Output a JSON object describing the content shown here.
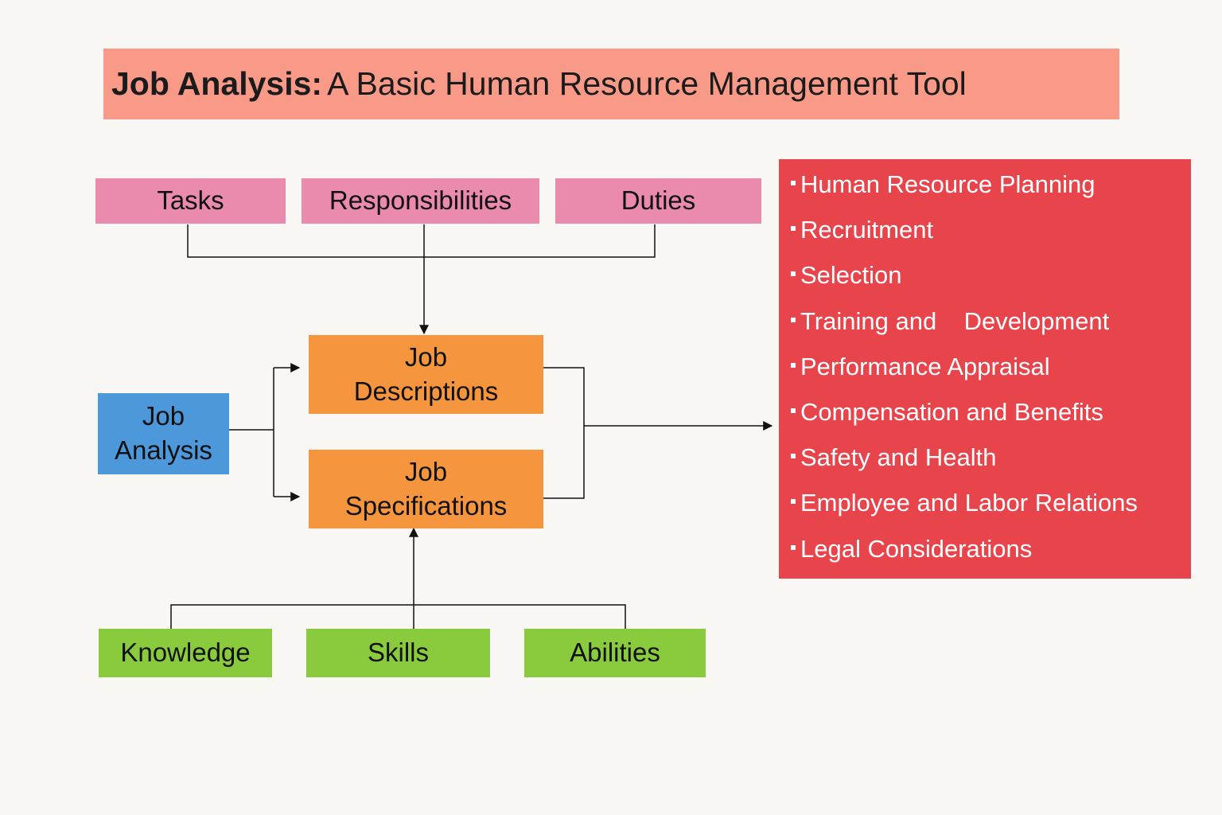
{
  "title": {
    "bold": "Job Analysis:",
    "rest": "A Basic Human Resource Management Tool"
  },
  "top_row": [
    "Tasks",
    "Responsibilities",
    "Duties"
  ],
  "source": {
    "line1": "Job",
    "line2": "Analysis"
  },
  "outputs": {
    "descriptions": {
      "line1": "Job",
      "line2": "Descriptions"
    },
    "specifications": {
      "line1": "Job",
      "line2": "Specifications"
    }
  },
  "bottom_row": [
    "Knowledge",
    "Skills",
    "Abilities"
  ],
  "uses": [
    "Human Resource Planning",
    "Recruitment",
    "Selection",
    "Training and    Development",
    "Performance Appraisal",
    "Compensation and Benefits",
    "Safety and Health",
    "Employee and Labor Relations",
    "Legal Considerations"
  ],
  "colors": {
    "title": "#f89a87",
    "top_row": "#ea8aad",
    "outputs": "#f5963e",
    "source": "#4d97db",
    "bottom_row": "#8acb3e",
    "uses_panel": "#e8444c"
  }
}
